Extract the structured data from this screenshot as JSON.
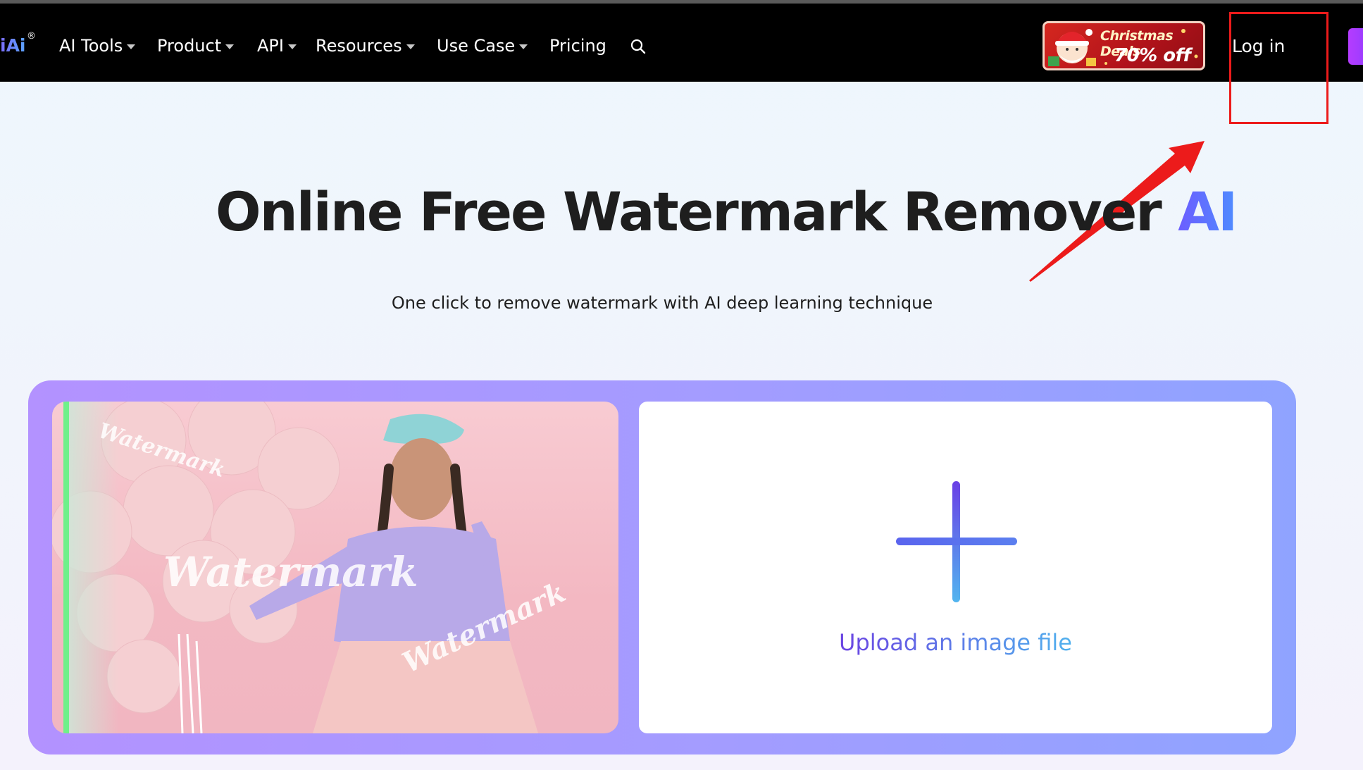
{
  "navbar": {
    "logo_text": "iAi",
    "logo_mark": "®",
    "items": [
      {
        "label": "AI Tools",
        "has_dropdown": true
      },
      {
        "label": "Product",
        "has_dropdown": true
      },
      {
        "label": "API",
        "has_dropdown": true
      },
      {
        "label": "Resources",
        "has_dropdown": true
      },
      {
        "label": "Use Case",
        "has_dropdown": true
      },
      {
        "label": "Pricing",
        "has_dropdown": false
      }
    ],
    "search_icon": "search-icon",
    "deal_banner": {
      "title": "Christmas Deals",
      "subtitle": "70% off"
    },
    "login_label": "Log in"
  },
  "hero": {
    "title_main": "Online Free Watermark Remover ",
    "title_accent": "AI",
    "subtitle": "One click to remove watermark with AI deep learning technique"
  },
  "demo": {
    "watermarks": [
      "Watermark",
      "Watermark",
      "Watermark"
    ]
  },
  "upload": {
    "icon": "plus-icon",
    "label": "Upload an image file"
  },
  "colors": {
    "navbar_bg": "#000000",
    "accent_purple": "#6c3fe2",
    "accent_blue": "#4fb6ee",
    "annotation_red": "#ec1b1b"
  }
}
